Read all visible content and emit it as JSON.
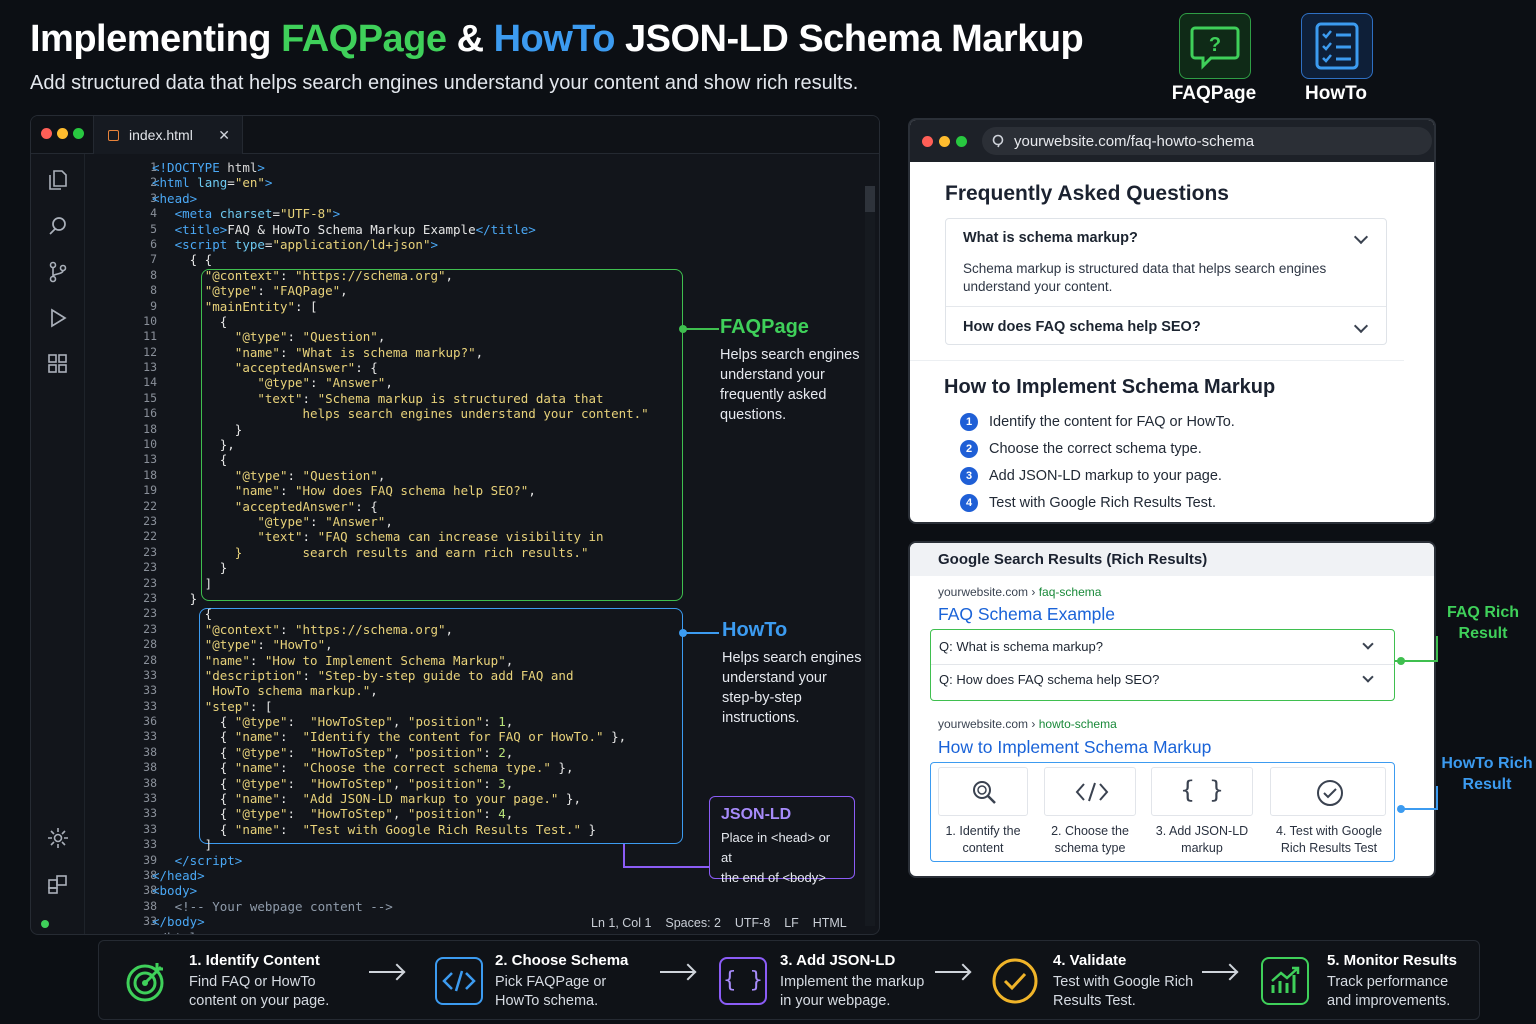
{
  "header": {
    "title_pre": "Implementing ",
    "title_faq": "FAQPage",
    "title_amp": " & ",
    "title_howto": "HowTo",
    "title_post": " JSON-LD Schema Markup",
    "subtitle": "Add structured data that helps search engines understand your content and show rich results.",
    "badges": [
      {
        "label": "FAQPage",
        "icon": "faq-chat-icon",
        "color": "#3fd05a"
      },
      {
        "label": "HowTo",
        "icon": "checklist-icon",
        "color": "#3c9bf0"
      }
    ]
  },
  "editor": {
    "tab": "index.html",
    "line_numbers": [
      "1",
      "2",
      "3",
      "4",
      "5",
      "6",
      "7",
      "8",
      "8",
      "9",
      "10",
      "11",
      "12",
      "13",
      "14",
      "15",
      "16",
      "18",
      "10",
      "13",
      "18",
      "19",
      "22",
      "23",
      "22",
      "23",
      "23",
      "23",
      "23",
      "23",
      "23",
      "28",
      "28",
      "33",
      "33",
      "33",
      "36",
      "33",
      "38",
      "38",
      "38",
      "33",
      "33",
      "33",
      "33",
      "39",
      "38",
      "38",
      "38",
      "33"
    ],
    "status": {
      "position": "Ln 1, Col 1",
      "spaces": "Spaces: 2",
      "encoding": "UTF-8",
      "eol": "LF",
      "language": "HTML"
    }
  },
  "annotations": {
    "faq": {
      "title": "FAQPage",
      "text": [
        "Helps search engines",
        "understand your",
        "frequently asked",
        "questions."
      ]
    },
    "howto": {
      "title": "HowTo",
      "text": [
        "Helps search engines",
        "understand your",
        "step-by-step",
        "instructions."
      ]
    },
    "jsonld": {
      "title": "JSON-LD",
      "text": [
        "Place in <head> or at",
        "the end of <body>"
      ]
    }
  },
  "browser": {
    "url": "yourwebsite.com/faq-howto-schema",
    "faq_heading": "Frequently Asked Questions",
    "q1": "What is schema markup?",
    "a1_line1": "Schema markup is structured data that helps search engines",
    "a1_line2": "understand your content.",
    "q2": "How does FAQ schema help SEO?",
    "howto_heading": "How to Implement Schema Markup",
    "steps": [
      "Identify the content for FAQ or HowTo.",
      "Choose the correct schema type.",
      "Add JSON-LD markup to your page.",
      "Test with Google Rich Results Test."
    ],
    "step_numbers": [
      "1",
      "2",
      "3",
      "4"
    ]
  },
  "serp": {
    "heading": "Google Search Results (Rich Results)",
    "result1": {
      "domain": "yourwebsite.com",
      "sep": " › ",
      "path": "faq-schema",
      "title": "FAQ Schema Example",
      "q1": "Q: What is schema markup?",
      "q2": "Q: How does FAQ schema help SEO?"
    },
    "result2": {
      "domain": "yourwebsite.com",
      "sep": " › ",
      "path": "howto-schema",
      "title": "How to Implement Schema Markup"
    },
    "cards": [
      {
        "l1": "1. Identify the",
        "l2": "content",
        "icon": "magnifier-icon"
      },
      {
        "l1": "2. Choose the",
        "l2": "schema type",
        "icon": "code-icon"
      },
      {
        "l1": "3. Add JSON-LD",
        "l2": "markup",
        "icon": "braces-icon"
      },
      {
        "l1": "4. Test with Google",
        "l2": "Rich Results Test",
        "icon": "check-circle-icon"
      }
    ],
    "side_faq": [
      "FAQ Rich",
      "Result"
    ],
    "side_howto": [
      "HowTo Rich",
      "Result"
    ]
  },
  "workflow": [
    {
      "title": "1. Identify Content",
      "l1": "Find FAQ or HowTo",
      "l2": "content on your page.",
      "icon": "target-icon",
      "color": "#3fd05a"
    },
    {
      "title": "2. Choose Schema",
      "l1": "Pick FAQPage or",
      "l2": "HowTo schema.",
      "icon": "code-icon",
      "color": "#3c9bf0"
    },
    {
      "title": "3. Add JSON-LD",
      "l1": "Implement the markup",
      "l2": "in your webpage.",
      "icon": "braces-icon",
      "color": "#8b5cf6"
    },
    {
      "title": "4. Validate",
      "l1": "Test with Google Rich",
      "l2": "Results Test.",
      "icon": "check-circle-icon",
      "color": "#f0b429"
    },
    {
      "title": "5. Monitor Results",
      "l1": "Track performance",
      "l2": "and improvements.",
      "icon": "growth-chart-icon",
      "color": "#3fd05a"
    }
  ],
  "colors": {
    "green": "#3fd05a",
    "blue": "#3c9bf0",
    "purple": "#8b5cf6",
    "yellow": "#f0b429"
  }
}
